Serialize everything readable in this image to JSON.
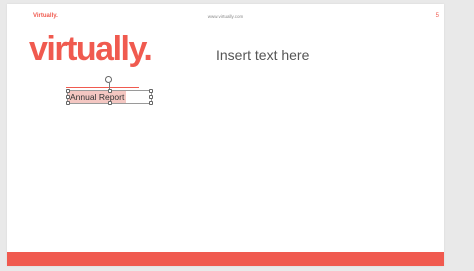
{
  "header": {
    "brand_small": "Virtually.",
    "url": "www.virtually.com",
    "page_number": "5"
  },
  "slide": {
    "brand_large": "virtually.",
    "placeholder_text": "Insert text here",
    "selected_textbox": "Annual Report"
  },
  "colors": {
    "accent": "#f05a4f",
    "selection_highlight": "#f4c7c2"
  }
}
